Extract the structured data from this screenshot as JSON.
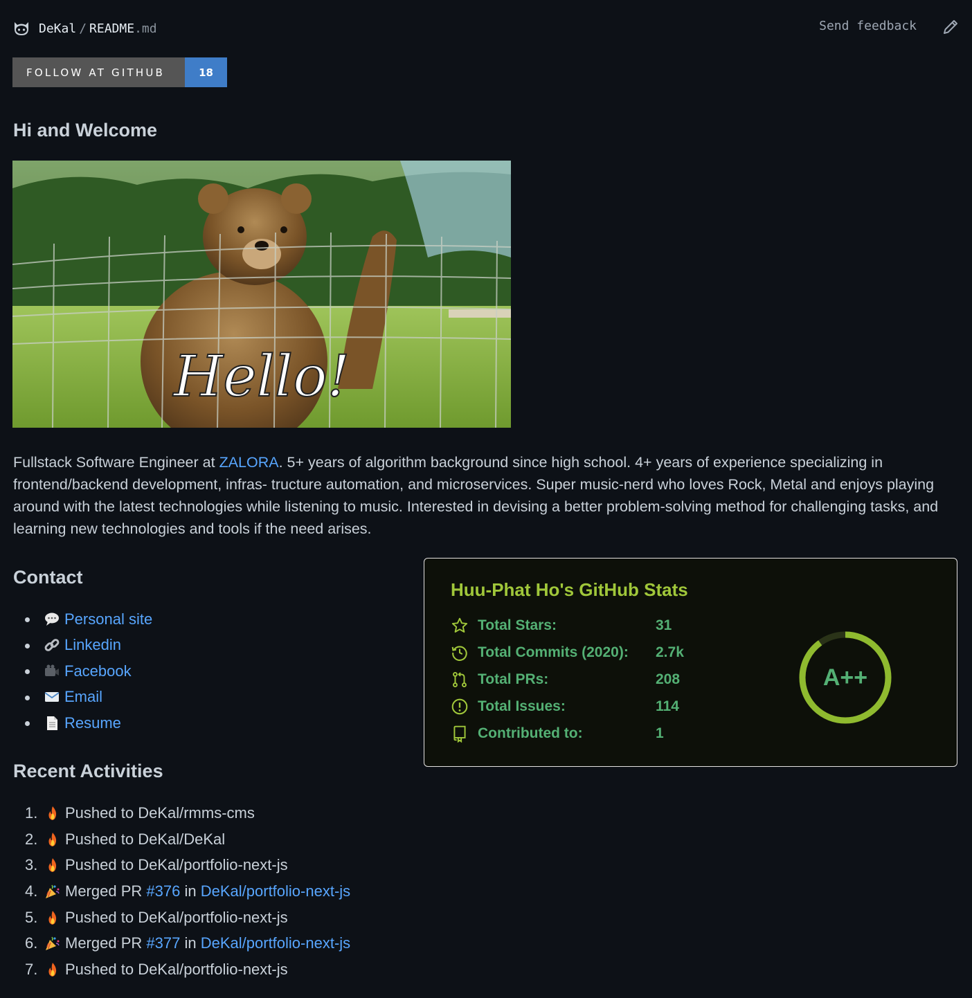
{
  "header": {
    "owner": "DeKal",
    "separator": "/",
    "file_name": "README",
    "file_ext": ".md",
    "feedback_label": "Send feedback"
  },
  "badge": {
    "label": "FOLLOW AT GITHUB",
    "count": "18"
  },
  "headings": {
    "welcome": "Hi and Welcome",
    "contact": "Contact",
    "activities": "Recent Activities"
  },
  "hero": {
    "caption": "Hello!"
  },
  "intro": {
    "before_link": "Fullstack Software Engineer at ",
    "link": "ZALORA",
    "after_link": ". 5+ years of algorithm background since high school. 4+ years of experience specializing in frontend/backend development, infras- tructure automation, and microservices. Super music-nerd who loves Rock, Metal and enjoys playing around with the latest technologies while listening to music. Interested in devising a better problem-solving method for challenging tasks, and learning new technologies and tools if the need arises."
  },
  "contact": [
    {
      "icon": "speech-bubble-icon",
      "label": "Personal site"
    },
    {
      "icon": "link-icon",
      "label": "Linkedin"
    },
    {
      "icon": "video-camera-icon",
      "label": "Facebook"
    },
    {
      "icon": "email-icon",
      "label": "Email"
    },
    {
      "icon": "document-icon",
      "label": "Resume"
    }
  ],
  "activities": [
    {
      "num": "1.",
      "icon": "fire-icon",
      "text": "Pushed to DeKal/rmms-cms"
    },
    {
      "num": "2.",
      "icon": "fire-icon",
      "text": "Pushed to DeKal/DeKal"
    },
    {
      "num": "3.",
      "icon": "fire-icon",
      "text": "Pushed to DeKal/portfolio-next-js"
    },
    {
      "num": "4.",
      "icon": "party-popper-icon",
      "prefix": "Merged PR ",
      "pr": "#376",
      "mid": " in ",
      "repo": "DeKal/portfolio-next-js"
    },
    {
      "num": "5.",
      "icon": "fire-icon",
      "text": "Pushed to DeKal/portfolio-next-js"
    },
    {
      "num": "6.",
      "icon": "party-popper-icon",
      "prefix": "Merged PR ",
      "pr": "#377",
      "mid": " in ",
      "repo": "DeKal/portfolio-next-js"
    },
    {
      "num": "7.",
      "icon": "fire-icon",
      "text": "Pushed to DeKal/portfolio-next-js"
    }
  ],
  "stats": {
    "title": "Huu-Phat Ho's GitHub Stats",
    "rows": [
      {
        "icon": "star-icon",
        "label": "Total Stars:",
        "value": "31"
      },
      {
        "icon": "history-icon",
        "label": "Total Commits (2020):",
        "value": "2.7k"
      },
      {
        "icon": "pull-request-icon",
        "label": "Total PRs:",
        "value": "208"
      },
      {
        "icon": "issue-icon",
        "label": "Total Issues:",
        "value": "114"
      },
      {
        "icon": "repo-icon",
        "label": "Contributed to:",
        "value": "1"
      }
    ],
    "rank": "A++",
    "rank_progress": 0.9,
    "colors": {
      "title": "#a0c73a",
      "text": "#54b074",
      "ring": "#8fba2f",
      "border": "#e4e2e2",
      "background": "#0d1009"
    }
  }
}
